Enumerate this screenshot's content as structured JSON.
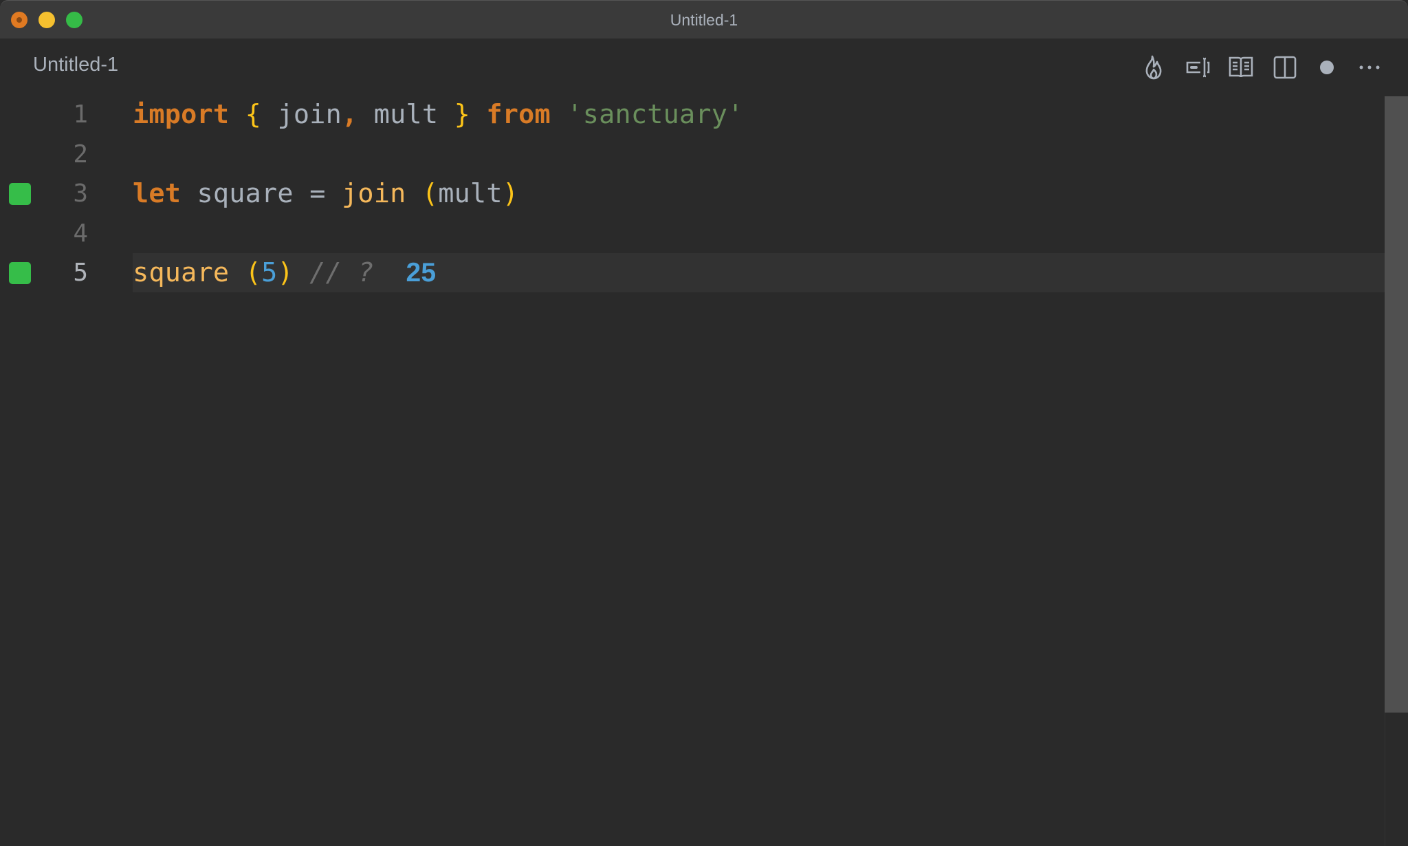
{
  "window": {
    "title": "Untitled-1",
    "controls": [
      "close",
      "minimize",
      "maximize"
    ]
  },
  "tab": {
    "label": "Untitled-1"
  },
  "toolbar": {
    "actions": [
      {
        "name": "flame-icon",
        "label": "Quokka"
      },
      {
        "name": "input-cursor-icon",
        "label": "Toggle"
      },
      {
        "name": "open-preview-icon",
        "label": "Open Preview"
      },
      {
        "name": "split-editor-icon",
        "label": "Split Editor"
      },
      {
        "name": "unsaved-dot-icon",
        "label": "Unsaved"
      },
      {
        "name": "more-actions-icon",
        "label": "More Actions"
      }
    ]
  },
  "editor": {
    "current_line": 5,
    "lines": [
      {
        "number": "1",
        "marker": false,
        "tokens": [
          {
            "t": "import",
            "c": "kw"
          },
          {
            "t": " ",
            "c": "id"
          },
          {
            "t": "{",
            "c": "br"
          },
          {
            "t": " join",
            "c": "id"
          },
          {
            "t": ",",
            "c": "kw"
          },
          {
            "t": " mult ",
            "c": "id"
          },
          {
            "t": "}",
            "c": "br"
          },
          {
            "t": " ",
            "c": "id"
          },
          {
            "t": "from",
            "c": "kw"
          },
          {
            "t": " ",
            "c": "id"
          },
          {
            "t": "'sanctuary'",
            "c": "str"
          }
        ]
      },
      {
        "number": "2",
        "marker": false,
        "tokens": []
      },
      {
        "number": "3",
        "marker": true,
        "tokens": [
          {
            "t": "let",
            "c": "kw"
          },
          {
            "t": " square ",
            "c": "id"
          },
          {
            "t": "=",
            "c": "op"
          },
          {
            "t": " ",
            "c": "id"
          },
          {
            "t": "join",
            "c": "fn"
          },
          {
            "t": " ",
            "c": "id"
          },
          {
            "t": "(",
            "c": "br"
          },
          {
            "t": "mult",
            "c": "id"
          },
          {
            "t": ")",
            "c": "br"
          }
        ]
      },
      {
        "number": "4",
        "marker": false,
        "tokens": []
      },
      {
        "number": "5",
        "marker": true,
        "tokens": [
          {
            "t": "square",
            "c": "fn"
          },
          {
            "t": " ",
            "c": "id"
          },
          {
            "t": "(",
            "c": "br"
          },
          {
            "t": "5",
            "c": "num"
          },
          {
            "t": ")",
            "c": "br"
          },
          {
            "t": " ",
            "c": "id"
          },
          {
            "t": "// ?",
            "c": "cm"
          },
          {
            "t": "  ",
            "c": "id"
          }
        ],
        "inline_result": "25"
      }
    ]
  },
  "colors": {
    "background": "#2a2a2a",
    "titlebar": "#3a3a3a",
    "keyword": "#d97b26",
    "identifier": "#a9b1bb",
    "function_call": "#f5b85b",
    "bracket": "#fcc419",
    "string": "#6a8f5c",
    "number": "#4a9fd8",
    "comment": "#6e6e6e",
    "coverage_marker": "#36bd49"
  }
}
